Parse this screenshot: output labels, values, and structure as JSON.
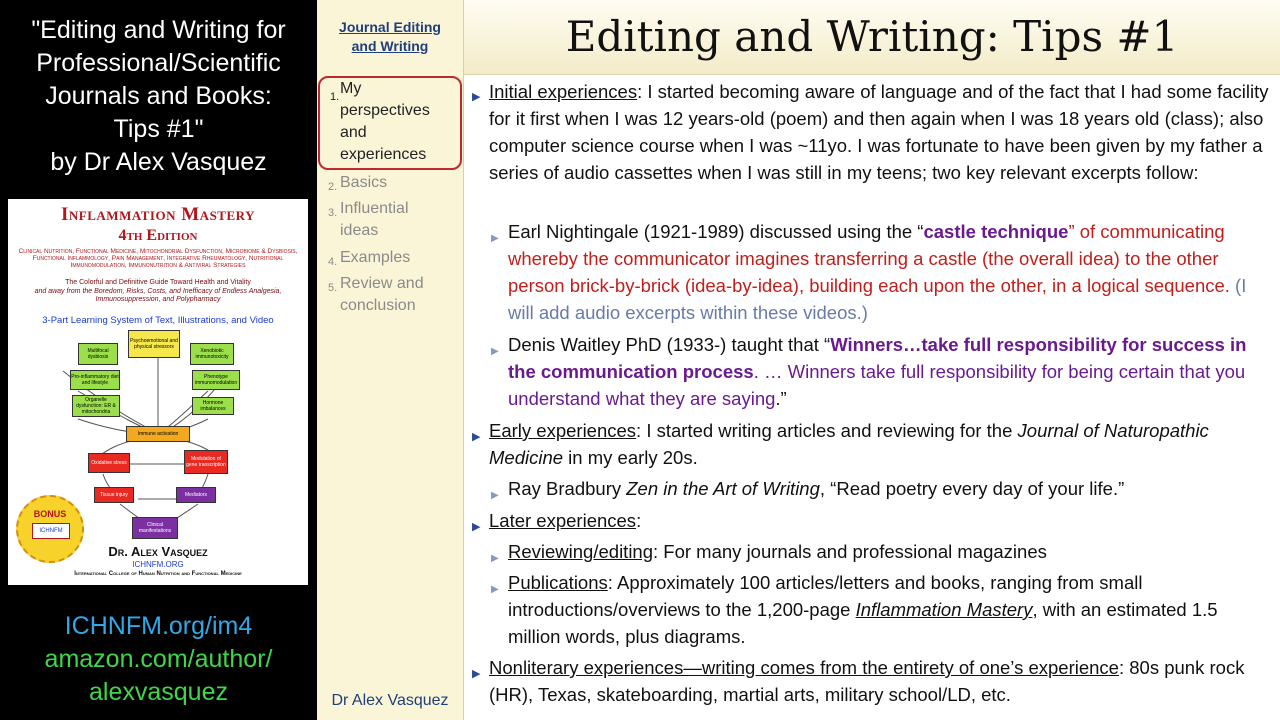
{
  "left": {
    "title_lines": [
      "\"Editing and Writing for",
      "Professional/Scientific",
      "Journals and Books:",
      "Tips #1\"",
      "by Dr Alex Vasquez"
    ],
    "cover": {
      "title": "Inflammation Mastery",
      "edition": "4th Edition",
      "topics": "Clinical Nutrition, Functional Medicine, Mitochondrial Dysfunction, Microbiome & Dysbiosis, Functional Inflammology, Pain Management, Integrative Rheumatology, Nutritional Immunomodulation, Immunonutrition & Antiviral Strategies",
      "tagline1": "The Colorful and Definitive Guide Toward Health and Vitality",
      "tagline2": "and away from the Boredom, Risks, Costs, and Inefficacy of Endless Analgesia, Immunosuppression, and Polypharmacy",
      "system": "3-Part Learning System of Text, Illustrations, and Video",
      "diagram": {
        "multifocal": "Multifocal dysbiosis",
        "psycho": "Psychoemotional and physical stressors",
        "xeno": "Xenobiotic immunotoxicity",
        "proinflam": "Pro-inflammatory diet and lifestyle",
        "phenotype": "Phenotype immunomodulation",
        "organelle": "Organelle dysfunction: ER & mitochondria",
        "hormone": "Hormone imbalances",
        "immune": "Immune activation",
        "oxidative": "Oxidative stress",
        "modulation": "Modulation of gene transcription",
        "tissue": "Tissue injury",
        "mediators": "Mediators",
        "clinical": "Clinical manifestations"
      },
      "bonus": "BONUS",
      "seal_org": "ICHNFM",
      "author": "Dr. Alex Vasquez",
      "site": "ICHNFM.ORG",
      "college": "International College of Human Nutrition and Functional Medicine"
    },
    "link1": "ICHNFM.org/im4",
    "link2a": "amazon.com/author/",
    "link2b": "alexvasquez",
    "colors": {
      "link1": "#32a8e8",
      "link2": "#3fd64a"
    }
  },
  "nav": {
    "title": "Journal Editing and Writing",
    "items": [
      {
        "num": "1.",
        "label": "My perspectives and experiences"
      },
      {
        "num": "2.",
        "label": "Basics"
      },
      {
        "num": "3.",
        "label": "Influential ideas"
      },
      {
        "num": "4.",
        "label": "Examples"
      },
      {
        "num": "5.",
        "label": "Review and conclusion"
      }
    ],
    "footer": "Dr Alex Vasquez"
  },
  "main": {
    "title": "Editing and Writing: Tips #1",
    "initial": {
      "label": "Initial experiences",
      "text": ": I started becoming aware of language and of the fact that I had some facility for it first when I was 12 years-old (poem) and then again when I was 18 years old (class); also computer science course when I was ~11yo. I was fortunate to have been given by my father a series of audio cassettes when I was still in my teens; two key relevant excerpts follow:"
    },
    "nightingale": {
      "lead": "Earl Nightingale (1921-1989) discussed using the “",
      "emph": "castle technique",
      "after": "” of communicating whereby the communicator imagines transferring a castle (the overall idea) to the other person brick-by-brick (idea-by-idea), building each upon the other, in a logical sequence.",
      "note": " (I will add audio excerpts within these videos.)"
    },
    "waitley": {
      "lead": "Denis Waitley PhD (1933-) taught that “",
      "emph": "Winners…take full responsibility for success in the communication process",
      "after": ". … Winners take full responsibility for being certain that you understand what they are saying",
      "close": ".”"
    },
    "early": {
      "label": "Early experiences",
      "text1": ": I started writing articles and reviewing for the ",
      "journal": "Journal of Naturopathic Medicine",
      "text2": " in my early 20s."
    },
    "bradbury": {
      "lead": "Ray Bradbury ",
      "book": "Zen in the Art of Writing",
      "quote": ", “Read poetry every day of your life.”"
    },
    "later": {
      "label": "Later experiences",
      "colon": ":"
    },
    "reviewing": {
      "label": "Reviewing/editing",
      "text": ": For many journals and professional magazines"
    },
    "publications": {
      "label": "Publications",
      "text1": ": Approximately 100 articles/letters and books, ranging from small introductions/overviews to the 1,200-page ",
      "book": "Inflammation Mastery",
      "text2": ", with an estimated 1.5 million words, plus diagrams."
    },
    "nonliterary": {
      "label": "Nonliterary experiences—writing comes from the entirety of one’s experience",
      "text": ": 80s punk rock (HR), Texas, skateboarding, martial arts, military school/LD, etc."
    }
  }
}
